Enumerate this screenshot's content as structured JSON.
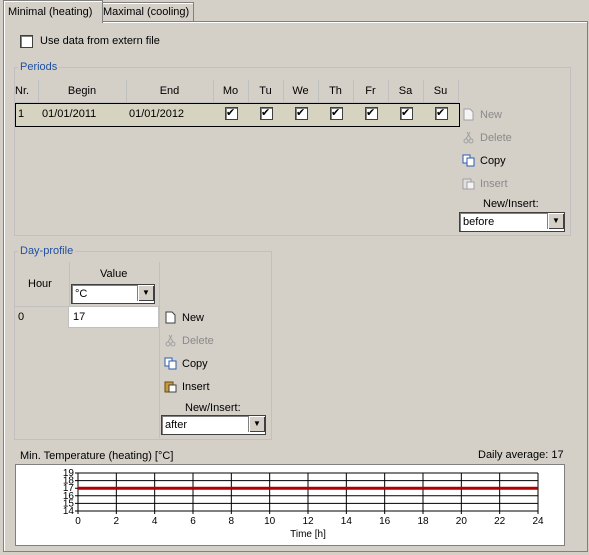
{
  "tabs": [
    {
      "label": "Minimal (heating)",
      "active": true
    },
    {
      "label": "Maximal (cooling)",
      "active": false
    }
  ],
  "extern_file": {
    "label": "Use data from extern file",
    "checked": false
  },
  "periods": {
    "title": "Periods",
    "columns": [
      "Nr.",
      "Begin",
      "End",
      "Mo",
      "Tu",
      "We",
      "Th",
      "Fr",
      "Sa",
      "Su"
    ],
    "rows": [
      {
        "nr": "1",
        "begin": "01/01/2011",
        "end": "01/01/2012",
        "days": [
          true,
          true,
          true,
          true,
          true,
          true,
          true
        ]
      }
    ],
    "buttons": {
      "new": "New",
      "delete": "Delete",
      "copy": "Copy",
      "insert": "Insert"
    },
    "new_insert_label": "New/Insert:",
    "new_insert_value": "before"
  },
  "day_profile": {
    "title": "Day-profile",
    "col_hour": "Hour",
    "col_value": "Value",
    "unit_value": "°C",
    "rows": [
      {
        "hour": "0",
        "value": "17"
      }
    ],
    "buttons": {
      "new": "New",
      "delete": "Delete",
      "copy": "Copy",
      "insert": "Insert"
    },
    "new_insert_label": "New/Insert:",
    "new_insert_value": "after"
  },
  "chart_title": "Min. Temperature (heating) [°C]",
  "daily_average": "Daily average: 17",
  "chart_data": {
    "type": "line",
    "x": [
      0,
      24
    ],
    "series": [
      {
        "values": [
          17,
          17
        ],
        "color": "#b00000"
      }
    ],
    "xlabel": "Time [h]",
    "ylabel": "",
    "xlim": [
      0,
      24
    ],
    "ylim": [
      14,
      19
    ],
    "xticks": [
      "0",
      "2",
      "4",
      "6",
      "8",
      "10",
      "12",
      "14",
      "16",
      "18",
      "20",
      "22",
      "24"
    ],
    "yticks": [
      "14",
      "15",
      "16",
      "17",
      "18",
      "19"
    ],
    "grid": true
  }
}
